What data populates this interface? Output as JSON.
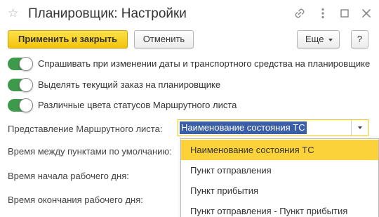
{
  "window": {
    "title": "Планировщик: Настройки",
    "icons": [
      "star-icon",
      "link-icon",
      "more-vertical-icon",
      "maximize-icon",
      "close-icon"
    ]
  },
  "toolbar": {
    "apply_close_label": "Применить и закрыть",
    "cancel_label": "Отменить",
    "more_label": "Еще",
    "help_label": "?"
  },
  "settings": {
    "toggles": [
      {
        "label": "Спрашивать при изменении даты и транспортного средства на планировщике",
        "checked": true
      },
      {
        "label": "Выделять текущий заказ на планировщике",
        "checked": true
      },
      {
        "label": "Различные цвета статусов Маршрутного листа",
        "checked": true
      }
    ],
    "fields": {
      "route_sheet_label": "Представление Маршрутного листа:",
      "route_sheet_value": "Наименование состояния ТС",
      "interval_label": "Время между пунктами по умолчанию:",
      "work_start_label": "Время начала рабочего дня:",
      "work_end_label": "Время окончания рабочего дня:"
    }
  },
  "dropdown": {
    "options": [
      "Наименование состояния ТС",
      "Пункт отправления",
      "Пункт прибытия",
      "Пункт отправления - Пункт прибытия"
    ],
    "selected_index": 0
  },
  "colors": {
    "accent_yellow": "#f3c30c",
    "toggle_green": "#3d9a4a",
    "selection_blue": "#3a5fa8",
    "dropdown_highlight": "#fbd23a"
  }
}
